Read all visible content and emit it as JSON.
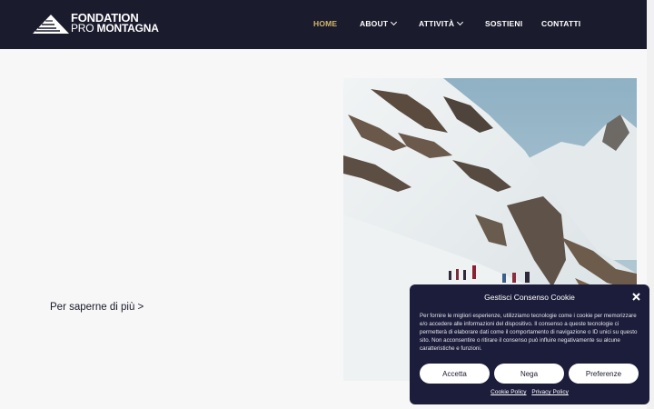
{
  "header": {
    "logo_line1": "FONDATION",
    "logo_line2_light": "PRO",
    "logo_line2_bold": "MONTAGNA",
    "nav": [
      {
        "label": "HOME",
        "active": true
      },
      {
        "label": "ABOUT",
        "dropdown": true
      },
      {
        "label": "ATTIVITÀ",
        "dropdown": true
      },
      {
        "label": "SOSTIENI"
      },
      {
        "label": "CONTATTI"
      }
    ]
  },
  "main": {
    "learn_more": "Per saperne di più >"
  },
  "cookie": {
    "title": "Gestisci Consenso Cookie",
    "text": "Per fornire le migliori esperienze, utilizziamo tecnologie come i cookie per memorizzare e/o accedere alle informazioni del dispositivo. Il consenso a queste tecnologie ci permetterà di elaborare dati come il comportamento di navigazione o ID unici su questo sito. Non acconsentire o ritirare il consenso può influire negativamente su alcune caratteristiche e funzioni.",
    "accept": "Accetta",
    "deny": "Nega",
    "preferences": "Preferenze",
    "cookie_policy": "Cookie Policy",
    "privacy_policy": "Privacy Policy"
  },
  "colors": {
    "header_bg": "#1a1b2d",
    "nav_active": "#d4b76a",
    "cookie_bg": "#1c1d3a"
  }
}
